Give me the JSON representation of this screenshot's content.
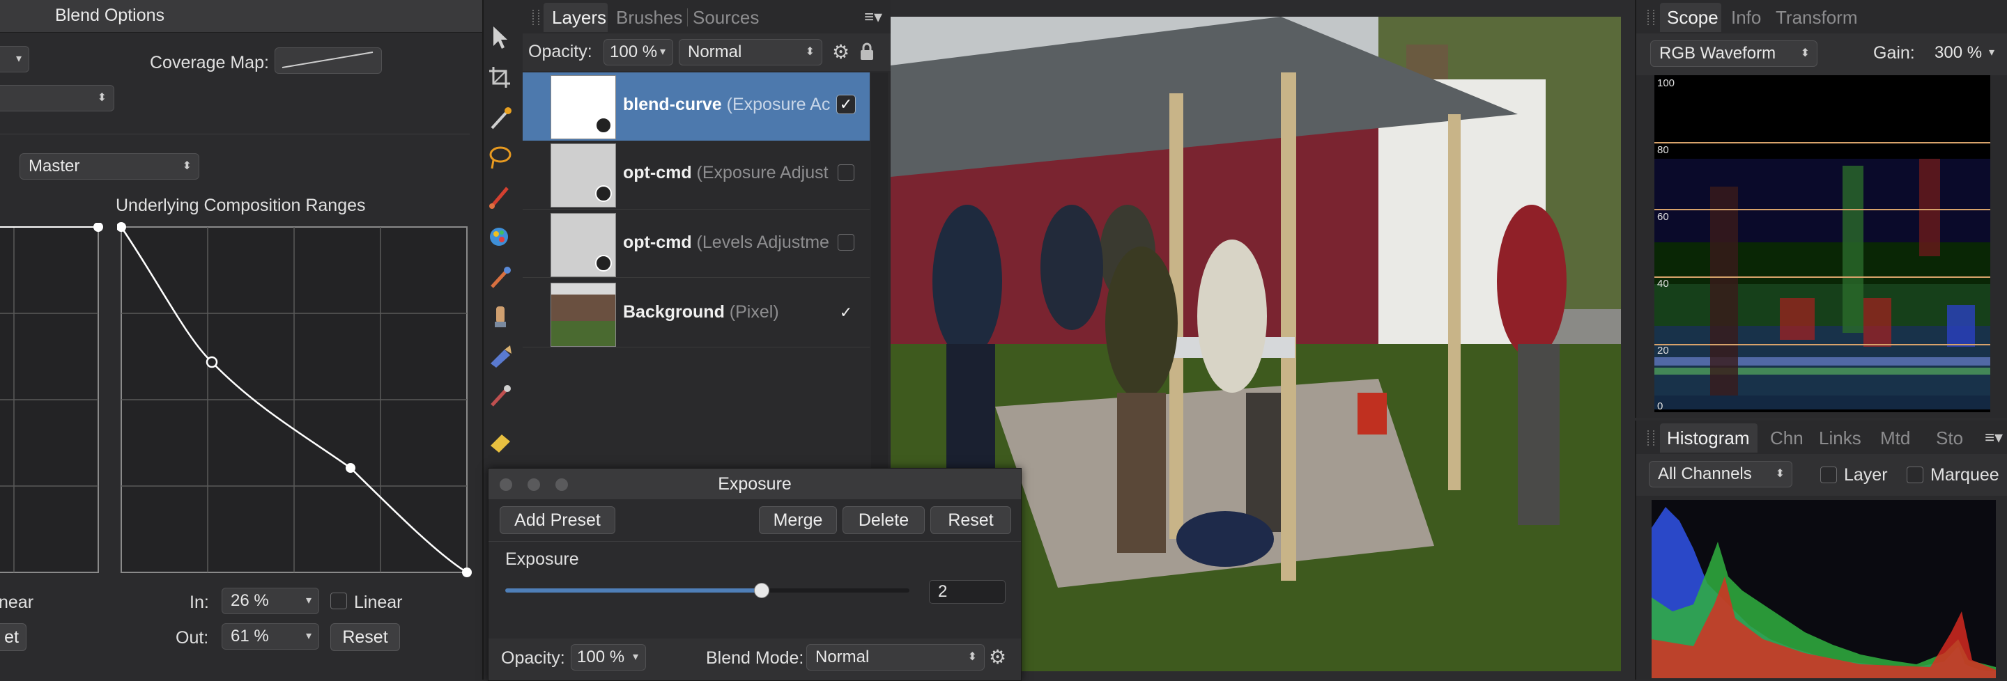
{
  "colors": {
    "accent": "#4f7fb8",
    "waveform_red": "#e53b2c",
    "waveform_green": "#33c04a",
    "waveform_blue": "#3b5cff",
    "guide": "#d8a36b"
  },
  "blend": {
    "title": "Blend Options",
    "coverage_label": "Coverage Map:",
    "channel": "Master",
    "underlying_label": "Underlying Composition Ranges",
    "left_linear_label": "near",
    "left_reset_label": "et",
    "in_label": "In:",
    "in_value": "26 %",
    "out_label": "Out:",
    "out_value": "61 %",
    "linear_label": "Linear",
    "reset_label": "Reset"
  },
  "layers_panel": {
    "tabs": [
      "Layers",
      "Brushes",
      "Sources"
    ],
    "opacity_label": "Opacity:",
    "opacity_value": "100 %",
    "blend_mode": "Normal",
    "items": [
      {
        "name": "blend-curve",
        "detail": " (Exposure Ac",
        "checked": true,
        "selected": true
      },
      {
        "name": "opt-cmd",
        "detail": " (Exposure Adjust",
        "checked": false,
        "selected": false
      },
      {
        "name": "opt-cmd",
        "detail": " (Levels Adjustme",
        "checked": false,
        "selected": false
      },
      {
        "name": "Background",
        "detail": " (Pixel)",
        "checked": true,
        "selected": false
      }
    ]
  },
  "exposure": {
    "title": "Exposure",
    "add_preset": "Add Preset",
    "merge": "Merge",
    "delete": "Delete",
    "reset": "Reset",
    "param_label": "Exposure",
    "value": "2",
    "slider_fraction": 0.635,
    "opacity_label": "Opacity:",
    "opacity_value": "100 %",
    "blend_mode_label": "Blend Mode:",
    "blend_mode_value": "Normal"
  },
  "scope": {
    "tabs": [
      "Scope",
      "Info",
      "Transform"
    ],
    "mode": "RGB Waveform",
    "gain_label": "Gain:",
    "gain_value": "300 %",
    "scale": [
      "100",
      "80",
      "60",
      "40",
      "20",
      "0"
    ]
  },
  "histogram": {
    "tabs": [
      "Histogram",
      "Chn",
      "Links",
      "Mtd",
      "Sto"
    ],
    "channels": "All Channels",
    "layer_label": "Layer",
    "marquee_label": "Marquee"
  }
}
